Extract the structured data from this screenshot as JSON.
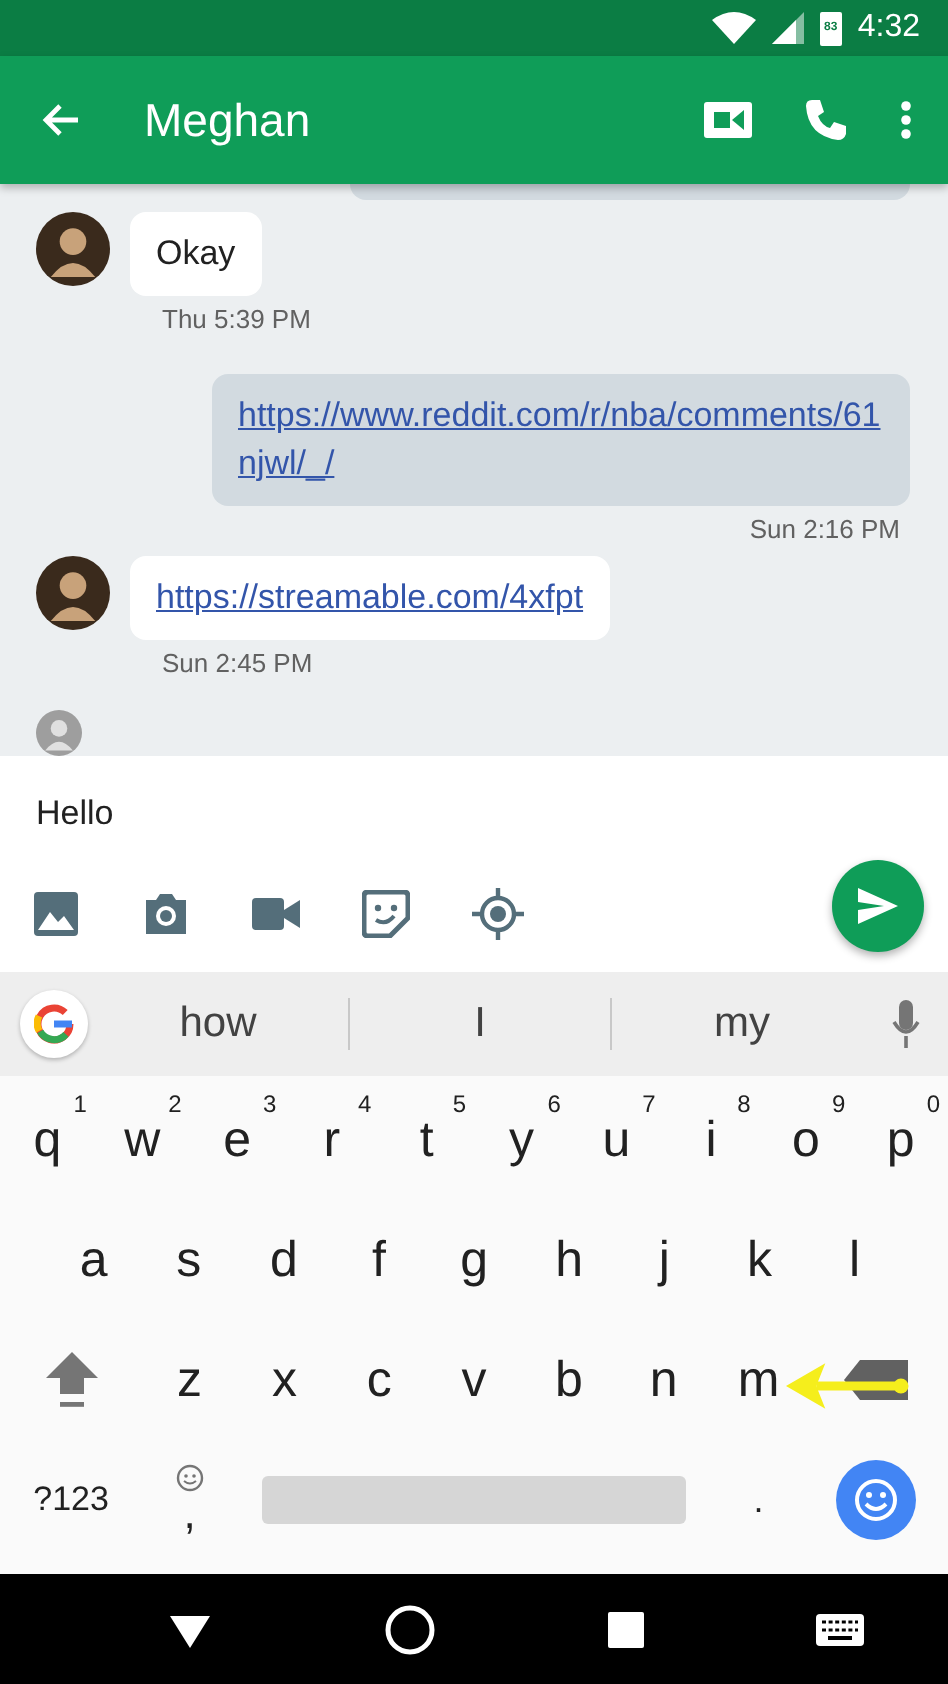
{
  "status_bar": {
    "battery": "83",
    "time": "4:32"
  },
  "app_bar": {
    "title": "Meghan"
  },
  "messages": [
    {
      "kind": "partial"
    },
    {
      "kind": "incoming",
      "text": "Okay",
      "link": false,
      "time": "Thu 5:39 PM"
    },
    {
      "kind": "outgoing",
      "text": "https://www.reddit.com/r/nba/comments/61njwl/_/",
      "link": true,
      "time": "Sun 2:16 PM"
    },
    {
      "kind": "incoming",
      "text": "https://streamable.com/4xfpt",
      "link": true,
      "time": "Sun 2:45 PM"
    },
    {
      "kind": "typing"
    }
  ],
  "composer": {
    "value": "Hello"
  },
  "suggestions": [
    "how",
    "I",
    "my"
  ],
  "keyboard": [
    [
      {
        "kind": "letter",
        "label": "q",
        "hint": "1"
      },
      {
        "kind": "letter",
        "label": "w",
        "hint": "2"
      },
      {
        "kind": "letter",
        "label": "e",
        "hint": "3"
      },
      {
        "kind": "letter",
        "label": "r",
        "hint": "4"
      },
      {
        "kind": "letter",
        "label": "t",
        "hint": "5"
      },
      {
        "kind": "letter",
        "label": "y",
        "hint": "6"
      },
      {
        "kind": "letter",
        "label": "u",
        "hint": "7"
      },
      {
        "kind": "letter",
        "label": "i",
        "hint": "8"
      },
      {
        "kind": "letter",
        "label": "o",
        "hint": "9"
      },
      {
        "kind": "letter",
        "label": "p",
        "hint": "0"
      }
    ],
    [
      {
        "kind": "letter",
        "label": "a"
      },
      {
        "kind": "letter",
        "label": "s"
      },
      {
        "kind": "letter",
        "label": "d"
      },
      {
        "kind": "letter",
        "label": "f"
      },
      {
        "kind": "letter",
        "label": "g"
      },
      {
        "kind": "letter",
        "label": "h"
      },
      {
        "kind": "letter",
        "label": "j"
      },
      {
        "kind": "letter",
        "label": "k"
      },
      {
        "kind": "letter",
        "label": "l"
      }
    ],
    [
      {
        "kind": "shift"
      },
      {
        "kind": "letter",
        "label": "z"
      },
      {
        "kind": "letter",
        "label": "x"
      },
      {
        "kind": "letter",
        "label": "c"
      },
      {
        "kind": "letter",
        "label": "v"
      },
      {
        "kind": "letter",
        "label": "b"
      },
      {
        "kind": "letter",
        "label": "n"
      },
      {
        "kind": "letter",
        "label": "m"
      },
      {
        "kind": "backspace"
      }
    ],
    [
      {
        "kind": "symbols",
        "label": "?123"
      },
      {
        "kind": "comma",
        "label": ","
      },
      {
        "kind": "space"
      },
      {
        "kind": "period",
        "label": "."
      },
      {
        "kind": "emoji"
      }
    ]
  ],
  "annotations": [
    {
      "kind": "arrow"
    }
  ]
}
